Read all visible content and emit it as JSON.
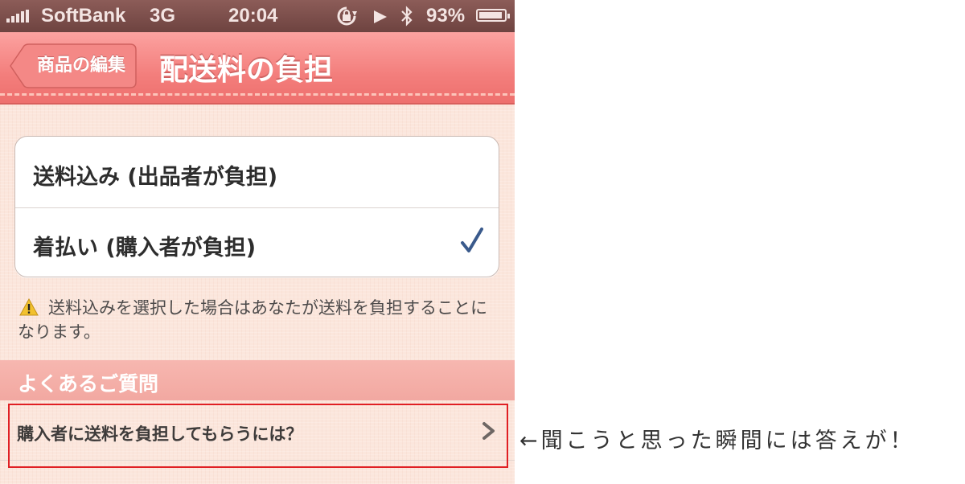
{
  "status_bar": {
    "carrier": "SoftBank",
    "network": "3G",
    "time": "20:04",
    "battery_percent": "93%"
  },
  "nav": {
    "back_label": "商品の編集",
    "title": "配送料の負担"
  },
  "options": [
    {
      "label": "送料込み (出品者が負担)",
      "selected": false
    },
    {
      "label": "着払い (購入者が負担)",
      "selected": true
    }
  ],
  "warning": {
    "icon": "warning-icon",
    "text": "送料込みを選択した場合はあなたが送料を負担することになります。"
  },
  "faq": {
    "header": "よくあるご質問",
    "item_label": "購入者に送料を負担してもらうには？"
  },
  "annotation": {
    "text": "←聞こうと思った瞬間には答えが！",
    "highlight_color": "#e02024"
  },
  "colors": {
    "nav_bar": "#f37e7c",
    "check": "#3a5a8c",
    "background": "#fbe6dc"
  }
}
